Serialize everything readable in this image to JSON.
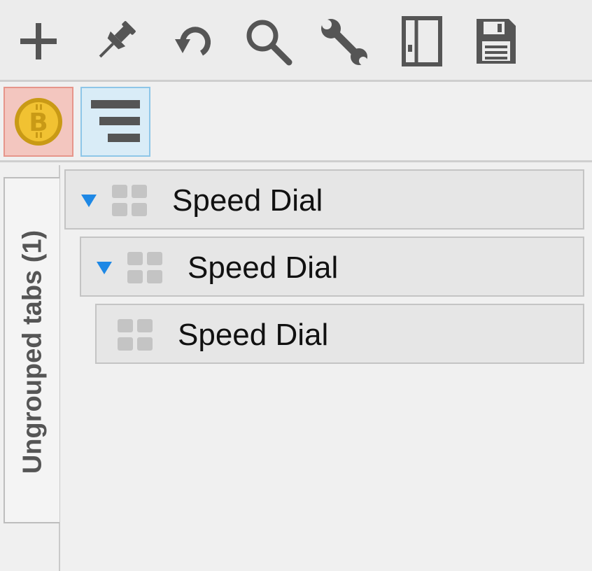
{
  "toolbar": {
    "buttons": [
      {
        "name": "new-tab",
        "icon": "plus-icon"
      },
      {
        "name": "pin",
        "icon": "pin-icon"
      },
      {
        "name": "undo",
        "icon": "undo-icon"
      },
      {
        "name": "search",
        "icon": "search-icon"
      },
      {
        "name": "settings",
        "icon": "wrench-icon"
      },
      {
        "name": "panel",
        "icon": "panel-icon"
      },
      {
        "name": "save",
        "icon": "save-icon"
      }
    ]
  },
  "filters": [
    {
      "name": "bitcoin-filter",
      "icon": "bitcoin-icon",
      "active": true,
      "bg": "#f3c6bf"
    },
    {
      "name": "tree-view",
      "icon": "tree-list-icon",
      "active": true,
      "bg": "#d9ecf7"
    }
  ],
  "side_tab": {
    "label": "Ungrouped tabs (1)"
  },
  "tabs": [
    {
      "title": "Speed Dial",
      "icon": "speed-dial-icon",
      "expanded": true
    },
    {
      "title": "Speed Dial",
      "icon": "speed-dial-icon",
      "expanded": true
    },
    {
      "title": "Speed Dial",
      "icon": "speed-dial-icon",
      "expanded": false
    }
  ],
  "colors": {
    "accent": "#1e88e5",
    "icon_gray": "#555555"
  }
}
